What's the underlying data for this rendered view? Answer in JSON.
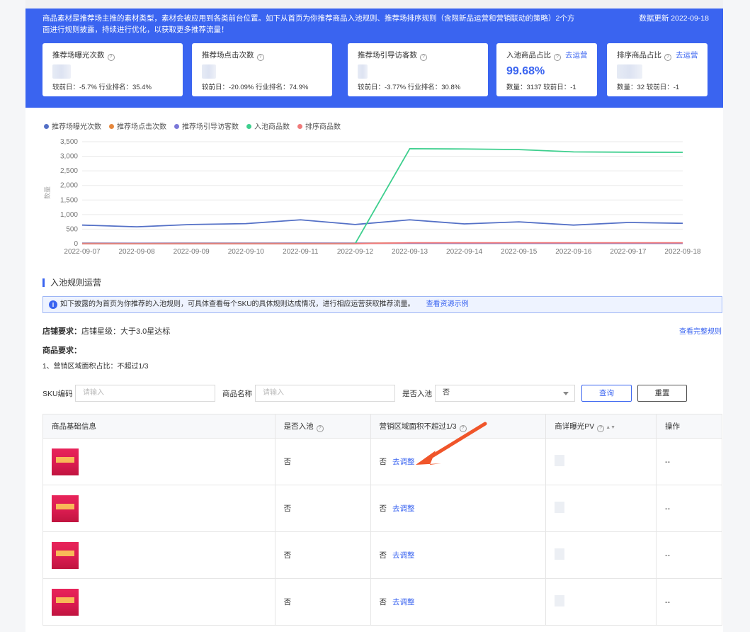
{
  "banner": {
    "description": "商品素材是推荐场主推的素材类型，素材会被应用到各类前台位置。如下从首页为你推荐商品入池规则、推荐场排序规则（含限新品运营和营销联动的策略）2个方面进行规则披露，持续进行优化，以获取更多推荐流量！",
    "update_label": "数据更新 2022-09-18"
  },
  "cards": [
    {
      "title": "推荐场曝光次数",
      "sub": "较前日：-5.7%    行业排名：35.4%",
      "value": "",
      "link": ""
    },
    {
      "title": "推荐场点击次数",
      "sub": "较前日：-20.09%    行业排名：74.9%",
      "value": "",
      "link": ""
    },
    {
      "title": "推荐场引导访客数",
      "sub": "较前日：-3.77%    行业排名：30.8%",
      "value": "",
      "link": ""
    },
    {
      "title": "入池商品占比",
      "sub": "数量：3137    较前日：-1",
      "value": "99.68%",
      "link": "去运营"
    },
    {
      "title": "排序商品占比",
      "sub": "数量：32    较前日：-1",
      "value": "",
      "link": "去运营"
    }
  ],
  "chart_data": {
    "type": "line",
    "x": [
      "2022-09-07",
      "2022-09-08",
      "2022-09-09",
      "2022-09-10",
      "2022-09-11",
      "2022-09-12",
      "2022-09-13",
      "2022-09-14",
      "2022-09-15",
      "2022-09-16",
      "2022-09-17",
      "2022-09-18"
    ],
    "ylim": [
      0,
      3500
    ],
    "yticks": [
      "0",
      "500",
      "1,000",
      "1,500",
      "2,000",
      "2,500",
      "3,000",
      "3,500"
    ],
    "ylabel": "数量",
    "legend_position": "top-left",
    "series": [
      {
        "name": "推荐场曝光次数",
        "color": "#5470c6",
        "values": [
          640,
          580,
          660,
          690,
          820,
          660,
          820,
          680,
          750,
          640,
          730,
          700
        ]
      },
      {
        "name": "推荐场点击次数",
        "color": "#e6873c",
        "values": [
          20,
          18,
          20,
          20,
          22,
          20,
          24,
          20,
          22,
          20,
          22,
          20
        ]
      },
      {
        "name": "推荐场引导访客数",
        "color": "#7b78d8",
        "values": [
          15,
          14,
          15,
          15,
          17,
          15,
          18,
          15,
          16,
          15,
          16,
          15
        ]
      },
      {
        "name": "入池商品数",
        "color": "#3ecf8e",
        "values": [
          0,
          0,
          0,
          0,
          0,
          0,
          3260,
          3250,
          3230,
          3150,
          3140,
          3137
        ]
      },
      {
        "name": "排序商品数",
        "color": "#f07a7a",
        "values": [
          0,
          0,
          0,
          0,
          0,
          0,
          32,
          32,
          32,
          32,
          32,
          32
        ]
      }
    ]
  },
  "section": {
    "title": "入池规则运营",
    "notice": "如下披露的为首页为你推荐的入池规则，可具体查看每个SKU的具体规则达成情况，进行相应运营获取推荐流量。",
    "notice_link": "查看资源示例",
    "store_req_label": "店铺要求：",
    "store_req_text": "店铺星级：大于3.0星达标",
    "view_rules": "查看完整规则",
    "item_req_label": "商品要求：",
    "item_req_1": "1、营销区域面积占比：不超过1/3"
  },
  "filters": {
    "sku_label": "SKU编码",
    "sku_placeholder": "请输入",
    "name_label": "商品名称",
    "name_placeholder": "请输入",
    "pool_label": "是否入池",
    "pool_value": "否",
    "query_button": "查询",
    "reset_button": "重置"
  },
  "table": {
    "headers": [
      "商品基础信息",
      "是否入池",
      "营销区域面积不超过1/3",
      "商详曝光PV",
      "操作"
    ],
    "rows": [
      {
        "in_pool": "否",
        "marketing": "否",
        "adjust": "去调整",
        "op": "--"
      },
      {
        "in_pool": "否",
        "marketing": "否",
        "adjust": "去调整",
        "op": "--"
      },
      {
        "in_pool": "否",
        "marketing": "否",
        "adjust": "去调整",
        "op": "--"
      },
      {
        "in_pool": "否",
        "marketing": "否",
        "adjust": "去调整",
        "op": "--"
      }
    ]
  },
  "colors": {
    "brand": "#3a64f0",
    "arrow": "#f0552a"
  }
}
